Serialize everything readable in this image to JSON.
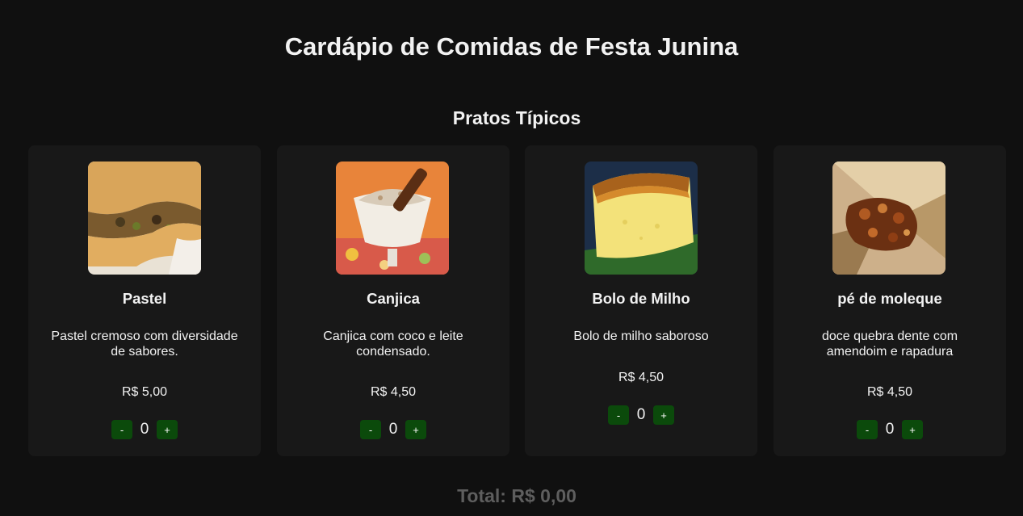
{
  "page_title": "Cardápio de Comidas de Festa Junina",
  "section_title": "Pratos Típicos",
  "currency": "R$",
  "items": [
    {
      "name": "Pastel",
      "description": "Pastel cremoso com diversidade de sabores.",
      "price": "R$ 5,00",
      "quantity": "0",
      "image": "pastel-image"
    },
    {
      "name": "Canjica",
      "description": "Canjica com coco e leite condensado.",
      "price": "R$ 4,50",
      "quantity": "0",
      "image": "canjica-image"
    },
    {
      "name": "Bolo de Milho",
      "description": "Bolo de milho saboroso",
      "price": "R$ 4,50",
      "quantity": "0",
      "image": "bolo-de-milho-image"
    },
    {
      "name": "pé de moleque",
      "description": "doce quebra dente com amendoim e rapadura",
      "price": "R$ 4,50",
      "quantity": "0",
      "image": "pe-de-moleque-image"
    }
  ],
  "controls": {
    "decrement_label": "-",
    "increment_label": "+"
  },
  "total": "Total: R$ 0,00",
  "colors": {
    "background": "#101010",
    "card": "#181818",
    "button": "#0b4a0b",
    "total_text": "#5e5e5e"
  }
}
